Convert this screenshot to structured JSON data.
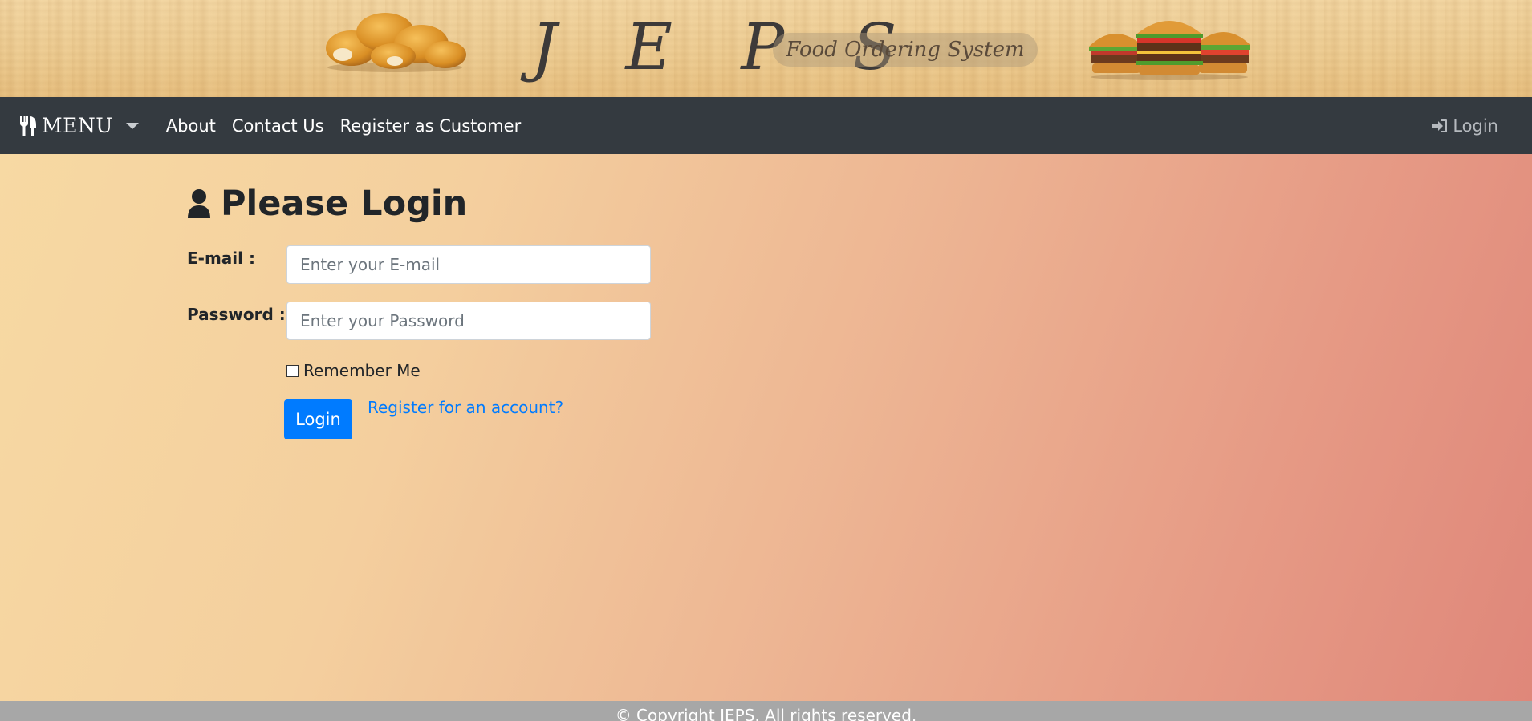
{
  "banner": {
    "brand": "J E P S",
    "tagline": "Food Ordering System",
    "left_image": "chicken-nuggets-image",
    "right_image": "burgers-image"
  },
  "navbar": {
    "menu_label": "MENU",
    "menu_icon": "utensils-icon",
    "links": [
      {
        "label": "About"
      },
      {
        "label": "Contact Us"
      },
      {
        "label": "Register as Customer"
      }
    ],
    "login_label": "Login",
    "login_icon": "sign-in-icon"
  },
  "login_form": {
    "heading": "Please Login",
    "heading_icon": "user-icon",
    "email_label": "E-mail :",
    "email_placeholder": "Enter your E-mail",
    "email_value": "",
    "password_label": "Password :",
    "password_placeholder": "Enter your Password",
    "password_value": "",
    "remember_label": "Remember Me",
    "remember_checked": false,
    "submit_label": "Login",
    "register_link": "Register for an account?"
  },
  "footer": {
    "copyright": "© Copyright JEPS. All rights reserved."
  },
  "colors": {
    "navbar_bg": "#343a40",
    "primary": "#007bff",
    "footer_bg": "#a7a7a7",
    "gradient_start": "#f7d9a3",
    "gradient_end": "#df877a"
  }
}
